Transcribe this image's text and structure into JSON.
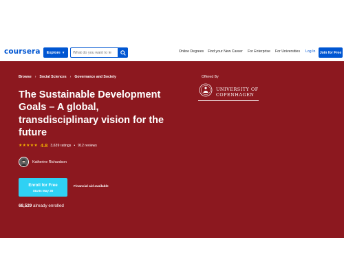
{
  "nav": {
    "logo": "coursera",
    "explore_label": "Explore",
    "search_placeholder": "What do you want to le",
    "links": [
      "Online Degrees",
      "Find your New Career",
      "For Enterprise",
      "For Universities"
    ],
    "login_label": "Log In",
    "join_label": "Join for Free"
  },
  "hero": {
    "breadcrumbs": [
      "Browse",
      "Social Sciences",
      "Governance and Society"
    ],
    "title": "The Sustainable Development Goals – A global, transdisciplinary vision for the future",
    "stars": "★★★★★",
    "rating": "4.8",
    "ratings_count": "3,639 ratings",
    "reviews_count": "912 reviews",
    "bullet": "•",
    "instructor": "Katherine Richardson",
    "enroll_label": "Enroll for Free",
    "enroll_sub": "Starts May 30",
    "financial_aid": "Financial aid available",
    "enrolled_count": "68,529",
    "enrolled_suffix": "already enrolled",
    "offered_by": "Offered By",
    "university_line1": "UNIVERSITY OF",
    "university_line2": "COPENHAGEN"
  },
  "colors": {
    "brand_blue": "#0056d2",
    "hero_bg": "#8c181f",
    "enroll_bg": "#2fd1f4",
    "star": "#f5b400"
  }
}
